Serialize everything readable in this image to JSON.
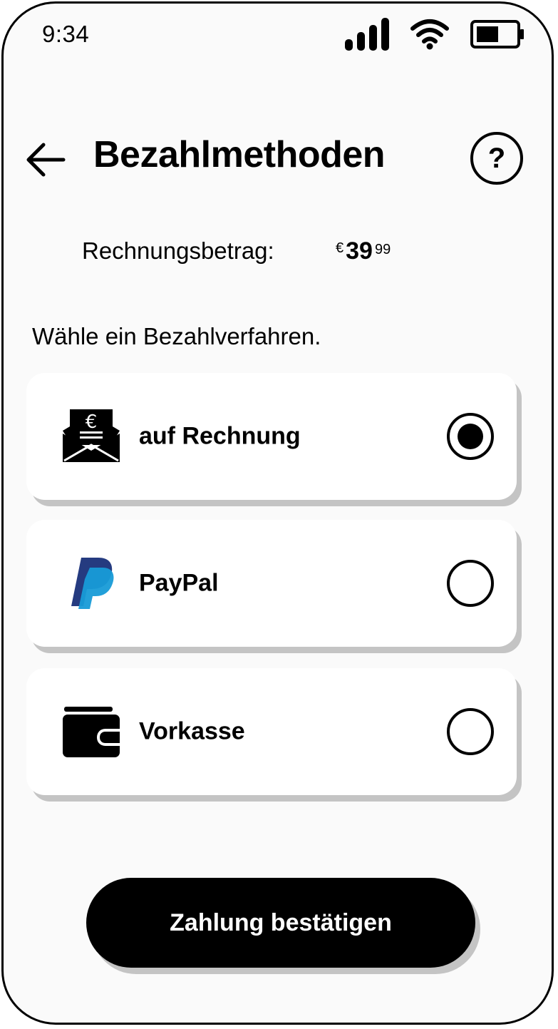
{
  "status_bar": {
    "time": "9:34",
    "icons": [
      "cellular-signal-icon",
      "wifi-icon",
      "battery-icon"
    ]
  },
  "header": {
    "title": "Bezahlmethoden",
    "back_icon": "arrow-left-icon",
    "help_label": "?"
  },
  "invoice": {
    "label": "Rechnungsbetrag:",
    "currency": "€",
    "amount_main": "39",
    "amount_cents": "99"
  },
  "instruction": "Wähle ein Bezahlverfahren.",
  "payment_methods": [
    {
      "label": "auf Rechnung",
      "icon": "invoice-envelope-icon",
      "selected": true
    },
    {
      "label": "PayPal",
      "icon": "paypal-icon",
      "selected": false
    },
    {
      "label": "Vorkasse",
      "icon": "wallet-icon",
      "selected": false
    }
  ],
  "confirm_button": {
    "label": "Zahlung bestätigen"
  },
  "colors": {
    "background": "#fafafa",
    "card": "#ffffff",
    "shadow": "#c4c4c4",
    "primary": "#000000",
    "paypal_dark": "#253b80",
    "paypal_light": "#179bd7"
  }
}
